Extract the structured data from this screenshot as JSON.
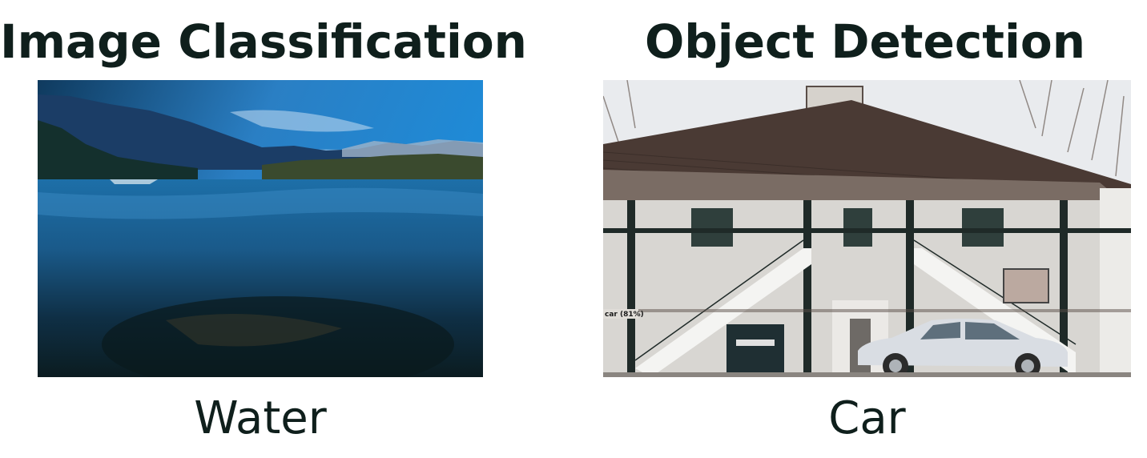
{
  "panels": [
    {
      "title": "Image Classification",
      "label": "Water"
    },
    {
      "title": "Object Detection",
      "label": "Car",
      "detection_tag": "car (81%)"
    }
  ],
  "colors": {
    "text": "#0f1f1c",
    "sky_blue": "#1f8ad6",
    "lake_dark": "#0d2226",
    "roof": "#4a3a34",
    "wall": "#d8d6d2"
  }
}
